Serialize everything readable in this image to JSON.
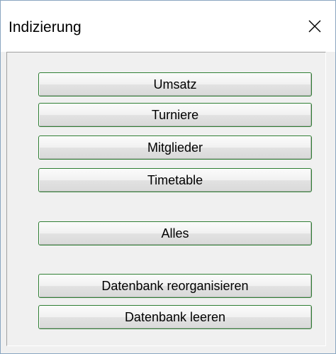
{
  "window": {
    "title": "Indizierung"
  },
  "buttons": {
    "umsatz": "Umsatz",
    "turniere": "Turniere",
    "mitglieder": "Mitglieder",
    "timetable": "Timetable",
    "alles": "Alles",
    "reorganize": "Datenbank reorganisieren",
    "clear": "Datenbank leeren"
  },
  "icons": {
    "close": "close-icon"
  },
  "colors": {
    "button_border": "#2e7d32",
    "dialog_background": "#f0f0f0",
    "titlebar_background": "#ffffff"
  }
}
